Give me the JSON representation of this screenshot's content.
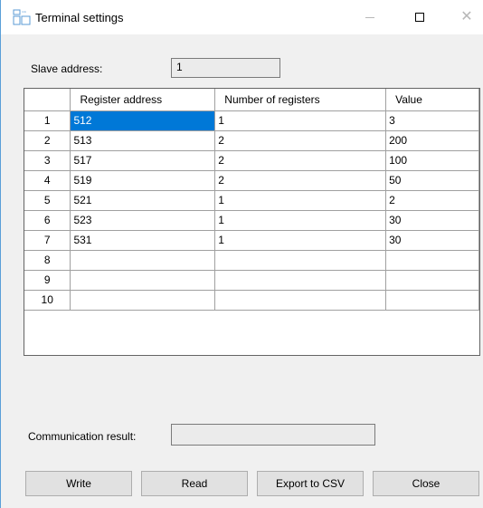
{
  "window": {
    "title": "Terminal settings",
    "icon": "terminal-app-icon",
    "controls": {
      "minimize": "minimize-icon",
      "maximize": "maximize-icon",
      "close": "close-icon"
    }
  },
  "slave_address": {
    "label": "Slave address:",
    "value": "1"
  },
  "table": {
    "columns": [
      "Register address",
      "Number of registers",
      "Value"
    ],
    "rows": [
      {
        "n": "1",
        "address": "512",
        "count": "1",
        "value": "3"
      },
      {
        "n": "2",
        "address": "513",
        "count": "2",
        "value": "200"
      },
      {
        "n": "3",
        "address": "517",
        "count": "2",
        "value": "100"
      },
      {
        "n": "4",
        "address": "519",
        "count": "2",
        "value": "50"
      },
      {
        "n": "5",
        "address": "521",
        "count": "1",
        "value": "2"
      },
      {
        "n": "6",
        "address": "523",
        "count": "1",
        "value": "30"
      },
      {
        "n": "7",
        "address": "531",
        "count": "1",
        "value": "30"
      },
      {
        "n": "8",
        "address": "",
        "count": "",
        "value": ""
      },
      {
        "n": "9",
        "address": "",
        "count": "",
        "value": ""
      },
      {
        "n": "10",
        "address": "",
        "count": "",
        "value": ""
      }
    ],
    "selection_color": "#0078d7"
  },
  "communication_result": {
    "label": "Communication result:",
    "value": ""
  },
  "buttons": {
    "write": "Write",
    "read": "Read",
    "export": "Export to CSV",
    "close": "Close"
  }
}
